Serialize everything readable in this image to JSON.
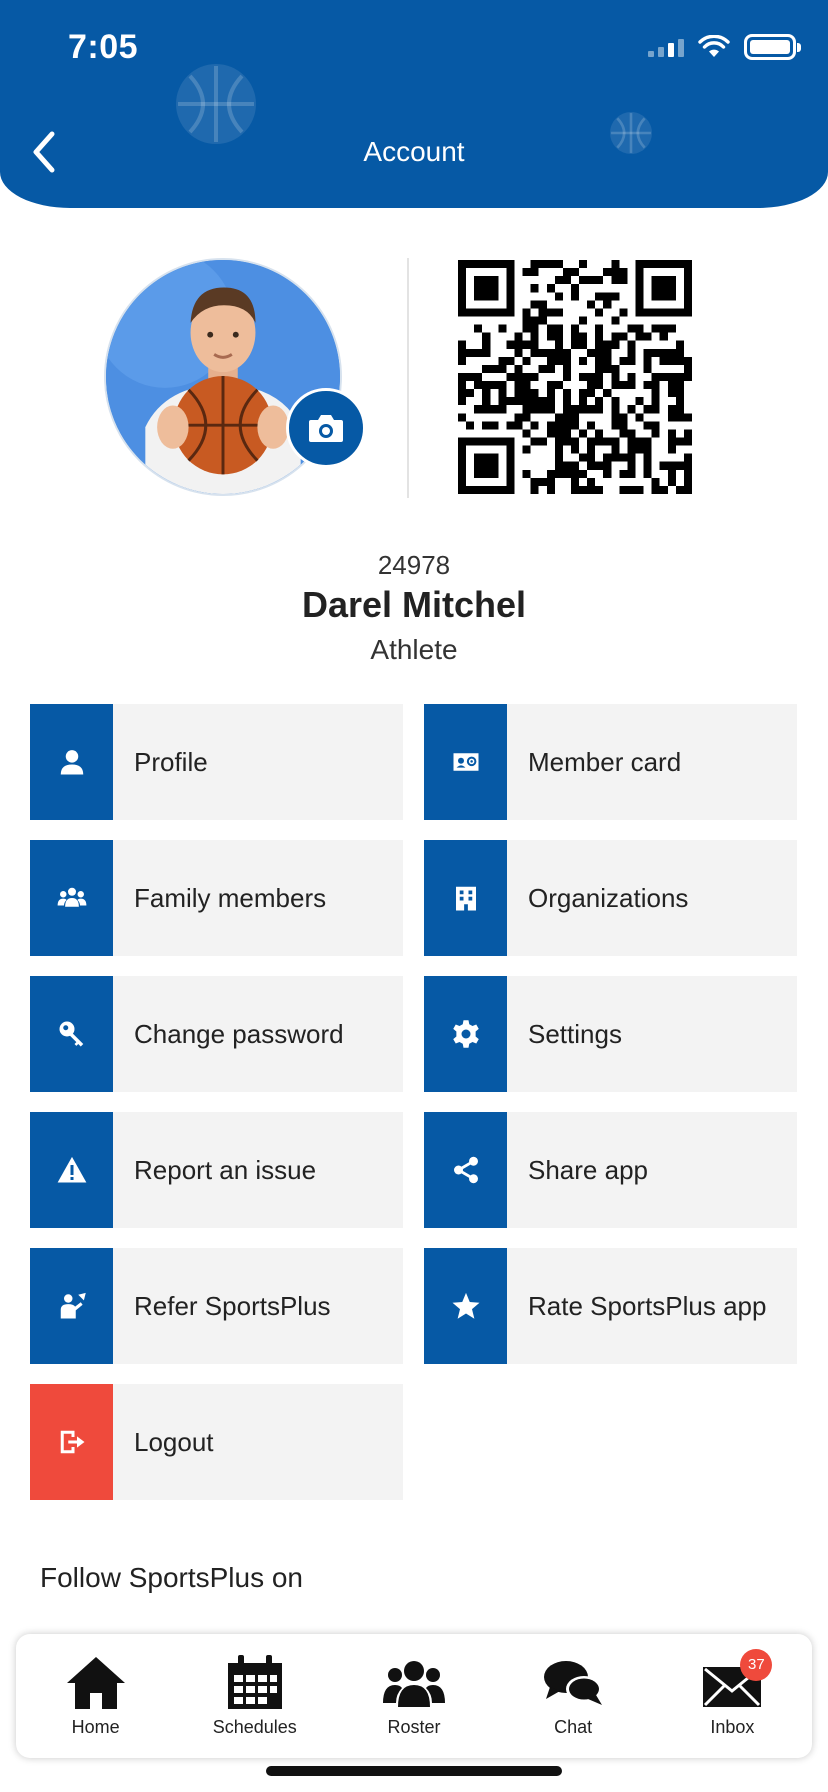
{
  "status_bar": {
    "time": "7:05"
  },
  "header": {
    "title": "Account"
  },
  "member": {
    "id": "24978",
    "name": "Darel Mitchel",
    "role": "Athlete"
  },
  "menu": [
    {
      "label": "Profile",
      "icon": "user-icon"
    },
    {
      "label": "Member card",
      "icon": "member-card-icon"
    },
    {
      "label": "Family members",
      "icon": "family-icon"
    },
    {
      "label": "Organizations",
      "icon": "building-icon"
    },
    {
      "label": "Change password",
      "icon": "key-icon"
    },
    {
      "label": "Settings",
      "icon": "gear-icon"
    },
    {
      "label": "Report an issue",
      "icon": "warning-icon"
    },
    {
      "label": "Share app",
      "icon": "share-icon"
    },
    {
      "label": "Refer SportsPlus",
      "icon": "refer-icon"
    },
    {
      "label": "Rate SportsPlus app",
      "icon": "star-icon"
    },
    {
      "label": "Logout",
      "icon": "logout-icon"
    }
  ],
  "follow_text": "Follow SportsPlus on",
  "tabs": [
    {
      "label": "Home",
      "icon": "home-icon"
    },
    {
      "label": "Schedules",
      "icon": "calendar-icon"
    },
    {
      "label": "Roster",
      "icon": "group-icon"
    },
    {
      "label": "Chat",
      "icon": "chat-icon"
    },
    {
      "label": "Inbox",
      "icon": "mail-icon",
      "badge": "37"
    }
  ],
  "colors": {
    "primary": "#0659a5",
    "danger": "#ef4a3c",
    "tile_bg": "#f3f3f3"
  }
}
